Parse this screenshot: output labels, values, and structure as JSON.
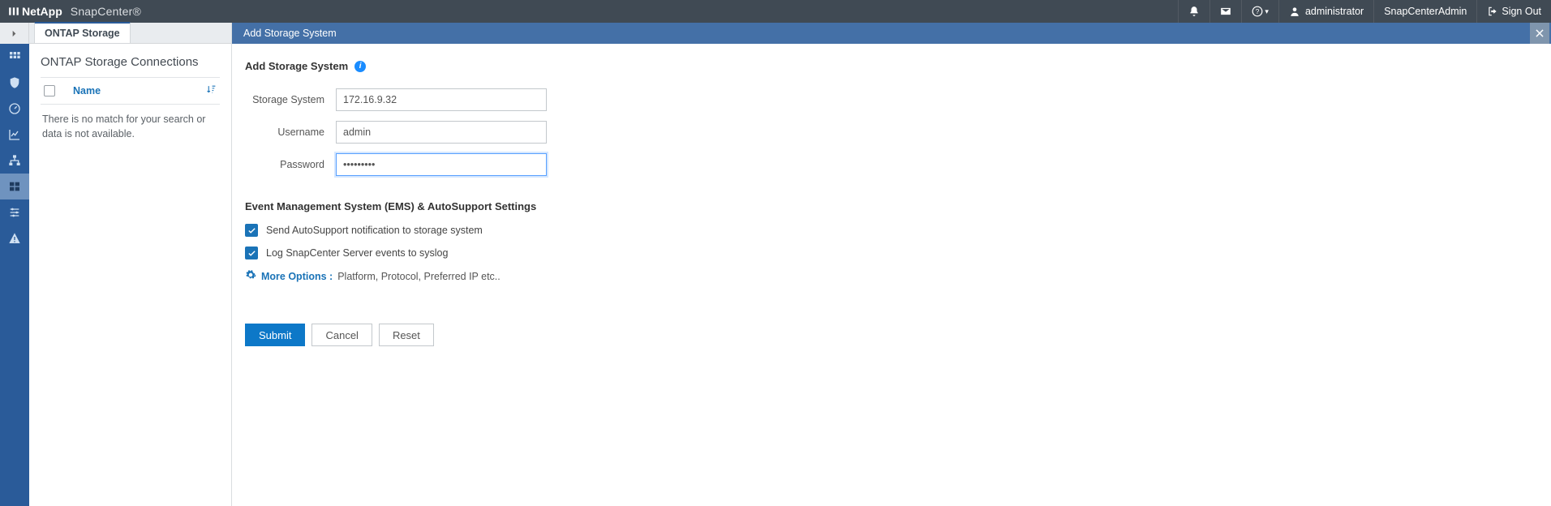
{
  "header": {
    "brand_company": "NetApp",
    "brand_product": "SnapCenter®",
    "user_label": "administrator",
    "role_label": "SnapCenterAdmin",
    "signout_label": "Sign Out"
  },
  "sidebar": {
    "toggle_hint": "expand",
    "items": [
      {
        "name": "dashboard-icon"
      },
      {
        "name": "shield-icon"
      },
      {
        "name": "gauge-icon"
      },
      {
        "name": "chart-icon"
      },
      {
        "name": "topology-icon"
      },
      {
        "name": "storage-icon"
      },
      {
        "name": "settings-icon"
      },
      {
        "name": "alert-icon"
      }
    ],
    "active_index": 5
  },
  "tabs": {
    "items": [
      "ONTAP Storage"
    ],
    "active": 0
  },
  "list_panel": {
    "title": "ONTAP Storage Connections",
    "column_name": "Name",
    "empty_message": "There is no match for your search or data is not available."
  },
  "main_panel": {
    "header_title": "Add Storage System",
    "section_title": "Add Storage System",
    "fields": {
      "storage_system_label": "Storage System",
      "storage_system_value": "172.16.9.32",
      "username_label": "Username",
      "username_value": "admin",
      "password_label": "Password",
      "password_value": "•••••••••"
    },
    "ems_section_title": "Event Management System (EMS) & AutoSupport Settings",
    "checkboxes": {
      "autosupport_label": "Send AutoSupport notification to storage system",
      "autosupport_checked": true,
      "syslog_label": "Log SnapCenter Server events to syslog",
      "syslog_checked": true
    },
    "more_options_label": "More Options :",
    "more_options_hint": "Platform, Protocol, Preferred IP etc..",
    "buttons": {
      "submit": "Submit",
      "cancel": "Cancel",
      "reset": "Reset"
    }
  }
}
